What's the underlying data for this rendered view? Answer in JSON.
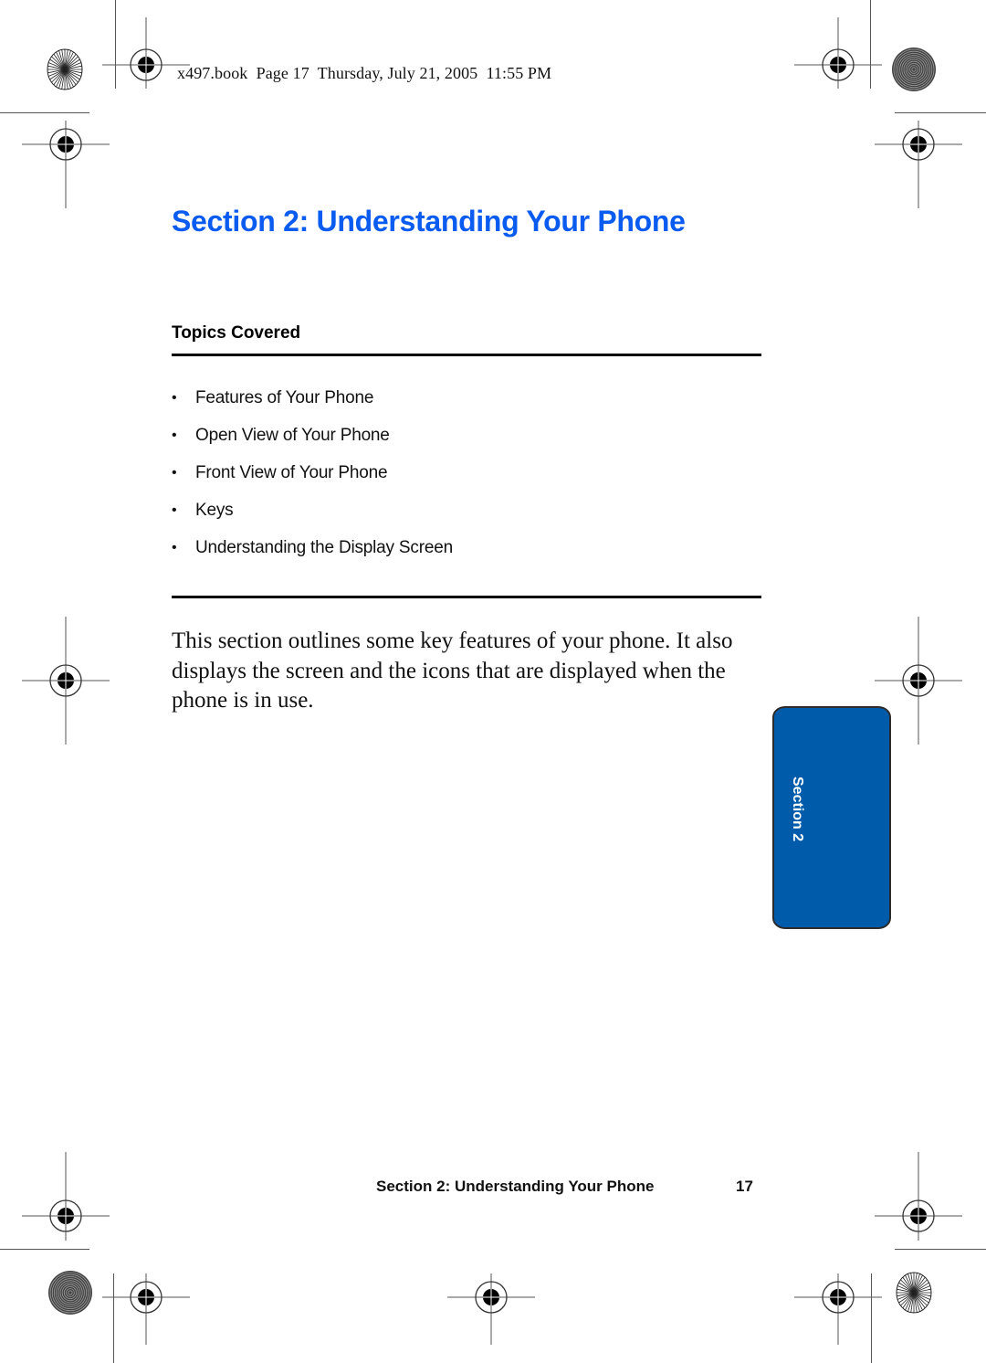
{
  "slug_line": "x497.book  Page 17  Thursday, July 21, 2005  11:55 PM",
  "section_title": "Section 2: Understanding Your Phone",
  "topics": {
    "heading": "Topics Covered",
    "items": [
      {
        "bullet": "•",
        "label": "Features of Your Phone"
      },
      {
        "bullet": "•",
        "label": "Open View of Your Phone"
      },
      {
        "bullet": "•",
        "label": "Front View of Your Phone"
      },
      {
        "bullet": "•",
        "label": "Keys"
      },
      {
        "bullet": "•",
        "label": "Understanding the Display Screen"
      }
    ]
  },
  "body_paragraph": "This section outlines some key features of your phone. It also displays the screen and the icons that are displayed when the phone is in use.",
  "side_tab": {
    "label": "Section 2",
    "color": "#005bab"
  },
  "footer": {
    "running_title": "Section 2: Understanding Your Phone",
    "page_number": "17"
  },
  "colors": {
    "title_blue": "#0a5bf0",
    "tab_blue": "#005bab"
  },
  "print_marks": {
    "registration_target_icon": "crosshair-target-icon",
    "starburst_icon": "starburst-icon",
    "concentric_icon": "concentric-circles-icon"
  }
}
